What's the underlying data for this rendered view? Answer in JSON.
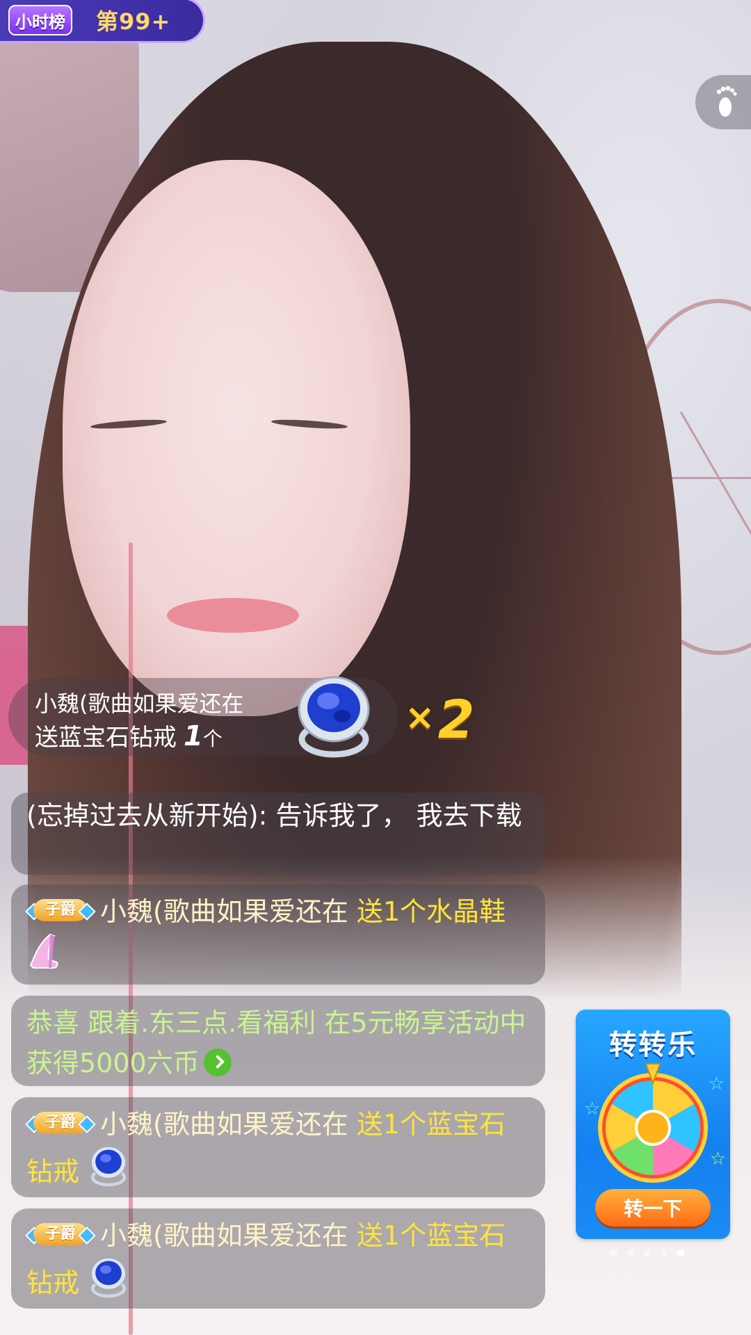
{
  "rank": {
    "badge": "小时榜",
    "position": "第99+"
  },
  "gift_banner": {
    "sender": "小魏(歌曲如果爱还在",
    "verb": "送",
    "gift_name": "蓝宝石钻戒",
    "count": "1",
    "unit": "个",
    "multiplier": "2"
  },
  "chat": {
    "partial": {
      "text": "(忘掉过去从新开始): 告诉我了， 我去下载"
    },
    "msg1": {
      "badge": "子爵",
      "name": "小魏(歌曲如果爱还在",
      "gift": "送1个水晶鞋"
    },
    "system": {
      "text": "恭喜 跟着.东三点.看福利  在5元畅享活动中获得5000六币"
    },
    "msg2": {
      "badge": "子爵",
      "name": "小魏(歌曲如果爱还在",
      "gift": "送1个蓝宝石钻戒"
    },
    "msg3": {
      "badge": "子爵",
      "name": "小魏(歌曲如果爱还在",
      "gift": "送1个蓝宝石钻戒"
    }
  },
  "wheel": {
    "title": "转转乐",
    "button": "转一下"
  },
  "colors": {
    "gift_text": "#ffe43a",
    "system_text": "#c9f590",
    "wheel_blue": "#1a8bf5",
    "wheel_button": "#ff6a18"
  },
  "icons": [
    "footprint-icon",
    "sapphire-ring-icon",
    "crystal-shoe-icon",
    "arrow-right-icon",
    "spin-wheel-icon"
  ]
}
